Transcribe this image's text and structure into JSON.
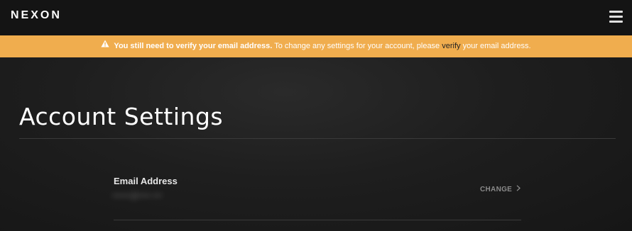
{
  "header": {
    "logo_text": "NEXON",
    "menu_icon": "hamburger-menu-icon"
  },
  "banner": {
    "icon": "warning-icon",
    "strong_text": "You still need to verify your email address.",
    "text_before_link": " To change any settings for your account, please ",
    "link_text": "verify",
    "text_after_link": " your email address.",
    "background_color": "#f0ad4e"
  },
  "main": {
    "title": "Account Settings",
    "email_row": {
      "label": "Email Address",
      "value_obscured": "••••••@••••.•••",
      "action_label": "CHANGE",
      "action_icon": "chevron-right-icon"
    }
  }
}
